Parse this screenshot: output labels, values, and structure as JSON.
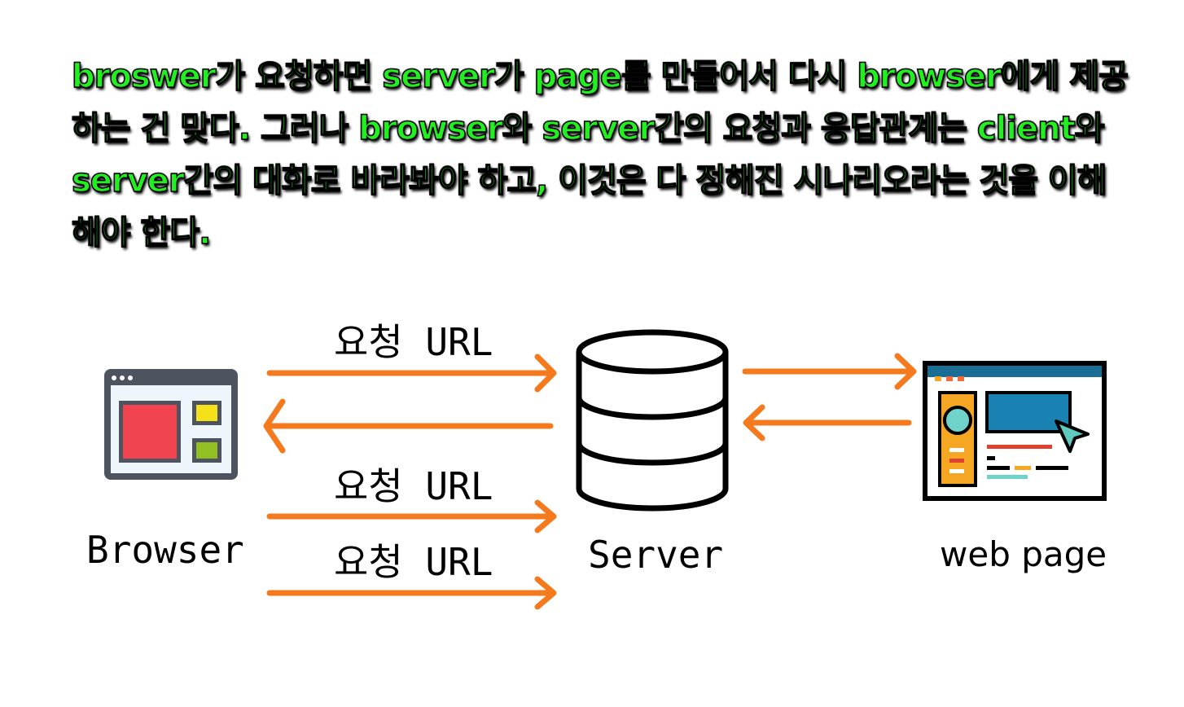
{
  "caption": {
    "text": "broswer가 요청하면 server가 page를 만들어서 다시 browser에게 제공하는 건 맞다.  그러나 browser와 server간의 요청과 응답관계는 client와 server간의 대화로 바라봐야 하고, 이것은 다 정해진 시나리오라는 것을 이해해야 한다."
  },
  "diagram": {
    "browser_label": "Browser",
    "server_label": "Server",
    "webpage_label": "web page",
    "request_labels": [
      "요청 URL",
      "요청 URL",
      "요청 URL"
    ],
    "colors": {
      "arrow": "#f57a1e",
      "caption_text": "#22ee22"
    }
  }
}
